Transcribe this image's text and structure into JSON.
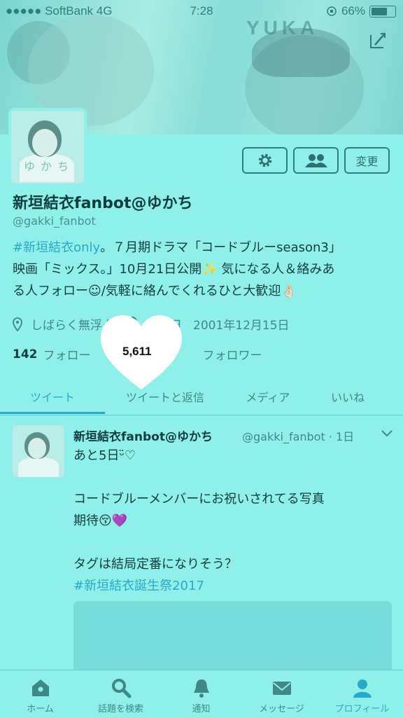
{
  "status_bar": {
    "carrier": "●●●●● SoftBank 4G",
    "time": "7:28",
    "battery": "66%"
  },
  "banner": {
    "watermark_text": "YUKA"
  },
  "profile": {
    "avatar_caption": "ゆかち",
    "name": "新垣結衣fanbot@ゆかち",
    "handle": "@gakki_fanbot",
    "edit_button": "変更",
    "bio": {
      "hashtag": "#新垣結衣only",
      "line1_rest": "。７月期ドラマ「コードブルーseason3」",
      "line2": "映画「ミックス。」10月21日公開✨ 気になる人＆絡みあ",
      "line3": "る人フォロー☺/気軽に絡んでくれるひと大歓迎👌🏻"
    },
    "location": "しばらく無浮上",
    "birthday_label": "誕生日",
    "birthday": "2001年12月15日",
    "following_count": "142",
    "following_label": "フォロー",
    "followers_count": "5,611",
    "followers_label": "フォロワー"
  },
  "tabs": [
    {
      "label": "ツイート",
      "active": true
    },
    {
      "label": "ツイートと返信",
      "active": false
    },
    {
      "label": "メディア",
      "active": false
    },
    {
      "label": "いいね",
      "active": false
    }
  ],
  "tweet": {
    "name": "新垣結衣fanbot@ゆかち",
    "meta": "@gakki_fanbot · 1日",
    "line1": "あと5日ᵕ̈♡",
    "line2": "コードブルーメンバーにお祝いされてる写真",
    "line3": "期待😚💜",
    "line4": "タグは結局定番になりそう？",
    "hashtag": "#新垣結衣誕生祭2017"
  },
  "bottom_nav": [
    {
      "label": "ホーム",
      "icon": "home-icon",
      "active": false
    },
    {
      "label": "話題を検索",
      "icon": "search-icon",
      "active": false
    },
    {
      "label": "通知",
      "icon": "bell-icon",
      "active": false
    },
    {
      "label": "メッセージ",
      "icon": "mail-icon",
      "active": false
    },
    {
      "label": "プロフィール",
      "icon": "profile-icon",
      "active": true
    }
  ],
  "colors": {
    "background": "#8ff0ea",
    "accent": "#2aa8c7",
    "text": "#0f3d40",
    "muted": "#3f8886"
  }
}
